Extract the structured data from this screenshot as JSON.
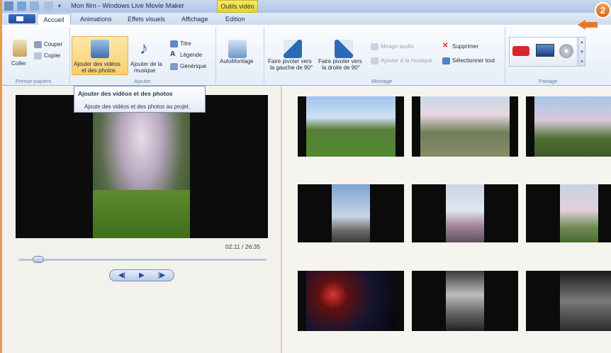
{
  "window": {
    "title": "Mon film - Windows Live Movie Maker",
    "context_tab": "Outils vidéo"
  },
  "tabs": [
    {
      "label": "Accueil",
      "active": true
    },
    {
      "label": "Animations",
      "active": false
    },
    {
      "label": "Effets visuels",
      "active": false
    },
    {
      "label": "Affichage",
      "active": false
    },
    {
      "label": "Edition",
      "active": false
    }
  ],
  "ribbon": {
    "clipboard": {
      "paste": "Coller",
      "cut": "Couper",
      "copy": "Copier",
      "group_label": "Presse-papiers"
    },
    "add": {
      "add_videos_line1": "Ajouter des vidéos",
      "add_videos_line2": "et des photos",
      "add_music_line1": "Ajouter de la",
      "add_music_line2": "musique",
      "title": "Titre",
      "caption": "Légende",
      "credits": "Générique",
      "group_label": "Ajouter"
    },
    "automovie": "AutoMontage",
    "editing": {
      "rotate_left_line1": "Faire pivoter vers",
      "rotate_left_line2": "la gauche de 90°",
      "rotate_right_line1": "Faire pivoter vers",
      "rotate_right_line2": "la droite de 90°",
      "snapshot": "Mirage audio",
      "add_to_music": "Ajouter à la musique",
      "delete": "Supprimer",
      "select_all": "Sélectionner tout",
      "group_label": "Montage"
    },
    "share": {
      "group_label": "Partage"
    }
  },
  "tooltip": {
    "title": "Ajouter des vidéos et des photos",
    "description": "Ajoute des vidéos et des photos au projet."
  },
  "player": {
    "time": "02:11 / 26:35",
    "progress": 0.08
  },
  "badge": "2",
  "colors": {
    "ribbon_highlight": "#f8cf6e",
    "context_tab": "#e6d23a",
    "badge": "#e07a2a"
  }
}
